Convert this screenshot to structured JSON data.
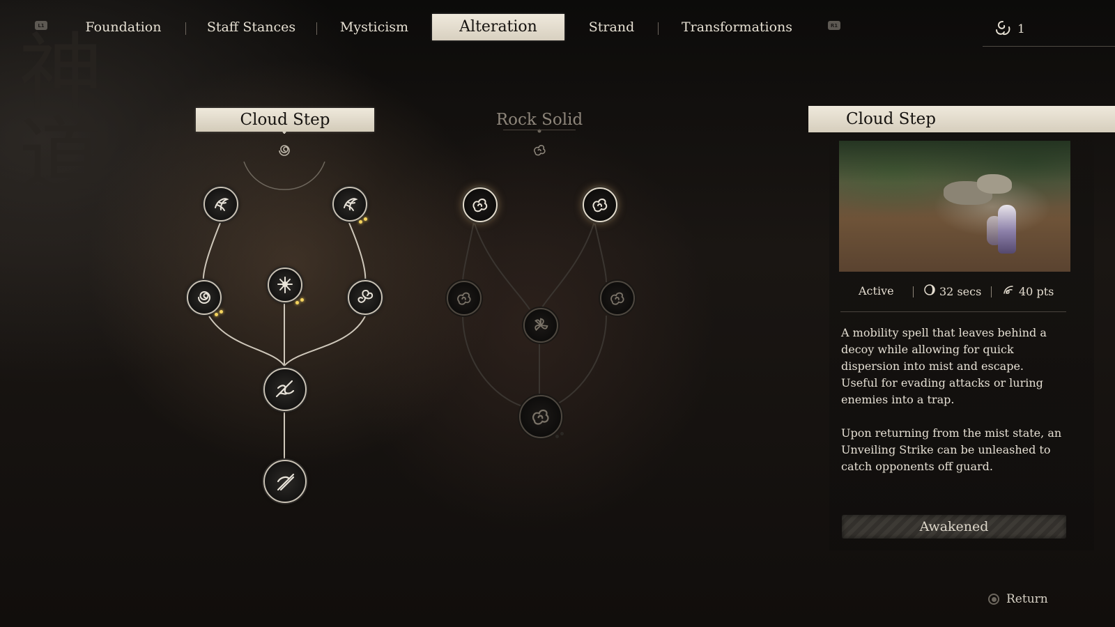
{
  "nav": {
    "left_bumper": "L1",
    "right_bumper": "R1",
    "tabs": [
      {
        "label": "Foundation",
        "active": false
      },
      {
        "label": "Staff Stances",
        "active": false
      },
      {
        "label": "Mysticism",
        "active": false
      },
      {
        "label": "Alteration",
        "active": true
      },
      {
        "label": "Strand",
        "active": false
      },
      {
        "label": "Transformations",
        "active": false
      }
    ],
    "points": "1",
    "points_icon": "spirit-swirl-icon"
  },
  "trees": [
    {
      "title": "Cloud Step",
      "selected": true,
      "root_icon": "swirl-icon",
      "nodes": [
        {
          "id": "cs-1",
          "icon": "feather-swirl-icon",
          "state": "lit",
          "pips": 0
        },
        {
          "id": "cs-2",
          "icon": "feather-swirl-icon",
          "state": "lit",
          "pips": 2
        },
        {
          "id": "cs-3",
          "icon": "wind-swirl-icon",
          "state": "lit",
          "pips": 2
        },
        {
          "id": "cs-4",
          "icon": "star-burst-icon",
          "state": "lit",
          "pips": 2
        },
        {
          "id": "cs-5",
          "icon": "triskele-icon",
          "state": "lit",
          "pips": 0
        },
        {
          "id": "cs-6",
          "icon": "strike-wave-icon",
          "state": "lit",
          "pips": 0
        },
        {
          "id": "cs-7",
          "icon": "staff-slash-icon",
          "state": "lit",
          "pips": 0
        }
      ]
    },
    {
      "title": "Rock Solid",
      "selected": false,
      "root_icon": "cloud-knot-icon",
      "nodes": [
        {
          "id": "rs-1",
          "icon": "cloud-knot-icon",
          "state": "glow",
          "pips": 0
        },
        {
          "id": "rs-2",
          "icon": "cloud-knot-icon",
          "state": "glow",
          "pips": 0
        },
        {
          "id": "rs-3",
          "icon": "cloud-knot-icon",
          "state": "dim",
          "pips": 0
        },
        {
          "id": "rs-4",
          "icon": "pinwheel-icon",
          "state": "dim",
          "pips": 0
        },
        {
          "id": "rs-5",
          "icon": "cloud-knot-icon",
          "state": "dim",
          "pips": 0
        },
        {
          "id": "rs-6",
          "icon": "cloud-knot-icon",
          "state": "dim",
          "pips": 0
        }
      ]
    }
  ],
  "detail": {
    "title": "Cloud Step",
    "type": "Active",
    "cooldown": "32 secs",
    "cooldown_icon": "moon-timer-icon",
    "cost": "40 pts",
    "cost_icon": "mana-swirl-icon",
    "description_1": "A mobility spell that leaves behind a decoy while allowing for quick dispersion into mist and escape. Useful for evading attacks or luring enemies into a trap.",
    "description_2": "Upon returning from the mist state, an Unveiling Strike can be unleashed to catch opponents off guard.",
    "status": "Awakened"
  },
  "footer": {
    "return_label": "Return",
    "return_icon": "circle-button-icon"
  },
  "colors": {
    "pip": "#f4d35e",
    "banner": "#efe9dc",
    "text": "#e6e0d3"
  }
}
